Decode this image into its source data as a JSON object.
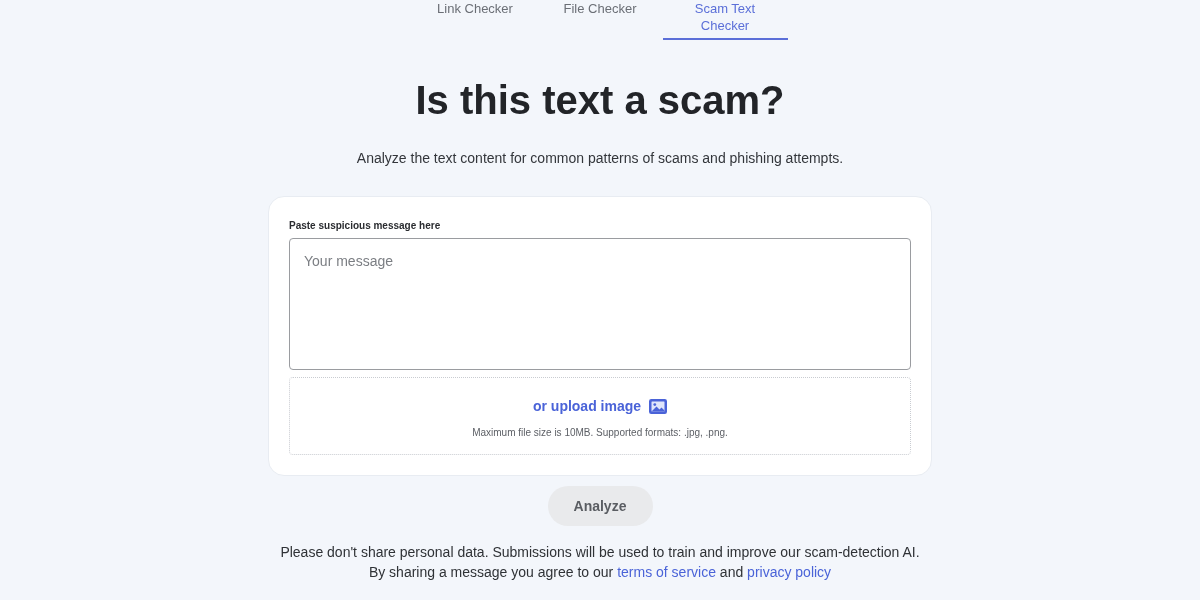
{
  "tabs": [
    {
      "label": "Link Checker",
      "selected": false
    },
    {
      "label": "File Checker",
      "selected": false
    },
    {
      "label": "Scam Text Checker",
      "selected": true
    }
  ],
  "heading": "Is this text a scam?",
  "subtitle": "Analyze the text content for common patterns of scams and phishing attempts.",
  "form": {
    "label": "Paste suspicious message here",
    "message": {
      "placeholder": "Your message"
    },
    "upload": {
      "link": "or upload image",
      "note": "Maximum file size is 10MB. Supported formats: .jpg, .png."
    }
  },
  "analyze_button": {
    "label": "Analyze",
    "disabled": true
  },
  "notice": [
    [
      {
        "kind": "text",
        "text": "Please don't share personal data. Submissions will be used to train and improve our scam-detection AI."
      }
    ],
    [
      {
        "kind": "text",
        "text": "By sharing a message you agree to our "
      },
      {
        "kind": "link",
        "text": "terms of service"
      },
      {
        "kind": "text",
        "text": " and "
      },
      {
        "kind": "link",
        "text": "privacy policy"
      }
    ]
  ]
}
